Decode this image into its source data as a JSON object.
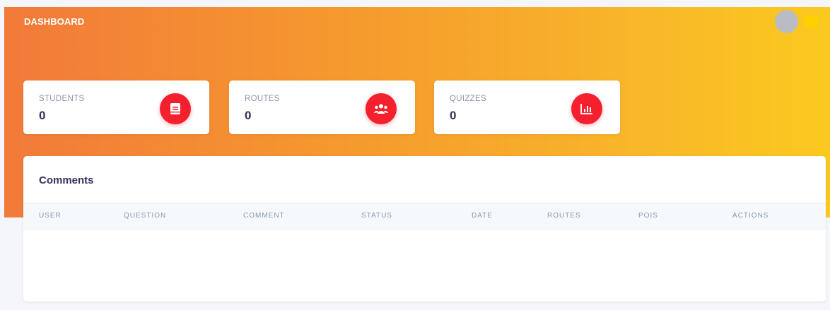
{
  "topbar": {
    "title": "DASHBOARD"
  },
  "stats": [
    {
      "label": "STUDENTS",
      "value": "0",
      "icon": "book-icon"
    },
    {
      "label": "ROUTES",
      "value": "0",
      "icon": "users-icon"
    },
    {
      "label": "QUIZZES",
      "value": "0",
      "icon": "chart-icon"
    }
  ],
  "comments": {
    "title": "Comments",
    "columns": [
      "USER",
      "QUESTION",
      "COMMENT",
      "STATUS",
      "DATE",
      "ROUTES",
      "POIS",
      "ACTIONS"
    ]
  },
  "colors": {
    "gradient_start": "#f27a3a",
    "gradient_end": "#fbc91f",
    "icon_bg": "#f5202d",
    "page_bg": "#f4f6fb"
  }
}
